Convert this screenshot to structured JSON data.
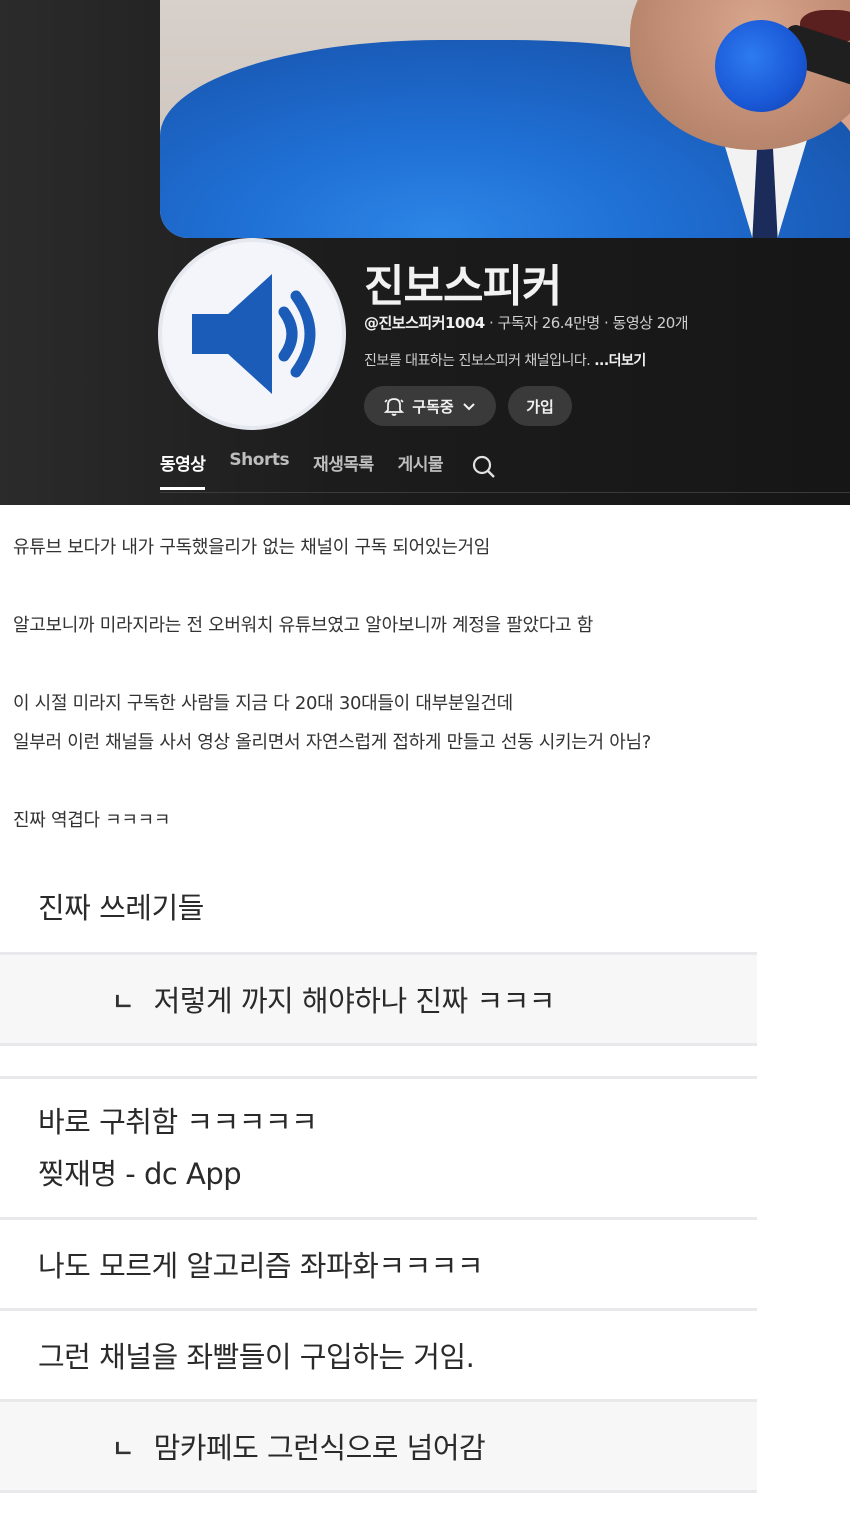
{
  "channel": {
    "name": "진보스피커",
    "handle": "@진보스피커1004",
    "stats": " · 구독자 26.4만명 · 동영상 20개",
    "description": "진보를 대표하는 진보스피커 채널입니다. ",
    "more_label": "...더보기",
    "subscribed_label": "구독중",
    "join_label": "가입",
    "tabs": [
      "동영상",
      "Shorts",
      "재생목록",
      "게시물"
    ]
  },
  "post": {
    "lines": [
      "유튜브 보다가 내가 구독했을리가 없는 채널이 구독 되어있는거임",
      "알고보니까 미라지라는 전 오버워치 유튜브였고 알아보니까 계정을 팔았다고 함",
      "이 시절 미라지 구독한 사람들 지금 다 20대 30대들이 대부분일건데",
      "일부러 이런 채널들 사서 영상 올리면서 자연스럽게 접하게 만들고 선동 시키는거 아님?",
      "진짜 역겹다 ㅋㅋㅋㅋ"
    ]
  },
  "comments": [
    {
      "text": "진짜 쓰레기들"
    },
    {
      "reply_marker": "ㄴ",
      "text": "저렇게 까지 해야하나 진짜 ㅋㅋㅋ"
    },
    {
      "text": "바로 구취함 ㅋㅋㅋㅋㅋ",
      "signature": "찢재명 - dc App"
    },
    {
      "text": "나도 모르게 알고리즘 좌파화ㅋㅋㅋㅋ"
    },
    {
      "text": "그런 채널을 좌빨들이 구입하는 거임."
    },
    {
      "reply_marker": "ㄴ",
      "text": "맘카페도 그런식으로 넘어감"
    }
  ],
  "colors": {
    "accent_blue": "#1a5cb8",
    "dark_bg": "#161616",
    "reply_bg": "#f7f7f8"
  },
  "icons": [
    "speaker-icon",
    "bell-icon",
    "chevron-down-icon",
    "search-icon"
  ]
}
